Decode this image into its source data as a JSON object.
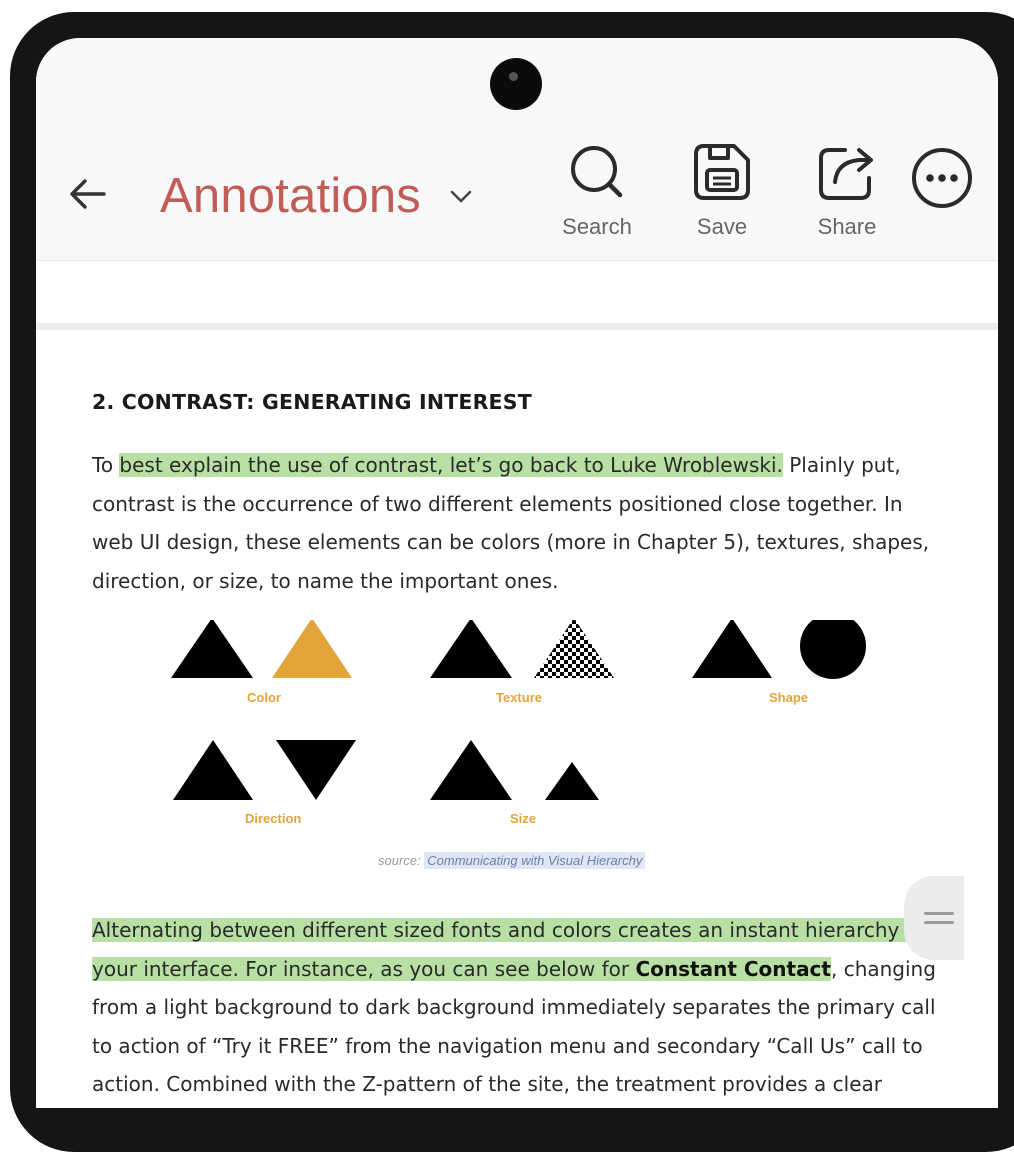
{
  "toolbar": {
    "title": "Annotations",
    "search_label": "Search",
    "save_label": "Save",
    "share_label": "Share"
  },
  "content": {
    "heading": "2. CONTRAST: GENERATING INTEREST",
    "p1": {
      "before": "To ",
      "highlight": "best explain the use of contrast, let’s go back to Luke Wroblewski.",
      "after": " Plainly put, contrast is the occurrence of two different elements positioned close together. In web UI design, these elements can be colors (more in Chapter 5), textures, shapes, direction, or size, to name the important ones."
    },
    "figure": {
      "labels": {
        "color": "Color",
        "texture": "Texture",
        "shape": "Shape",
        "direction": "Direction",
        "size": "Size"
      },
      "source_prefix": "source:",
      "source_link": "Communicating with Visual Hierarchy"
    },
    "p2": {
      "highlight1": "Alternating between different sized fonts and colors creates an instant hierarchy to your interface. For instance, as you can see below for ",
      "bold": "Constant Contact",
      "after": ", changing from a light background to dark background immediately separates the primary call to action of “Try it FREE” from the navigation menu and secondary “Call Us” call to action. Combined with the Z-pattern of the site, the treatment provides a clear"
    }
  },
  "colors": {
    "title": "#c45c56",
    "highlight": "#b9e0a4",
    "figure_accent": "#e3a43a"
  },
  "icons": {
    "back": "arrow-left-icon",
    "dropdown": "chevron-down-icon",
    "search": "search-icon",
    "save": "save-icon",
    "share": "share-icon",
    "more": "more-horizontal-icon",
    "scroll": "drag-handle-icon"
  }
}
